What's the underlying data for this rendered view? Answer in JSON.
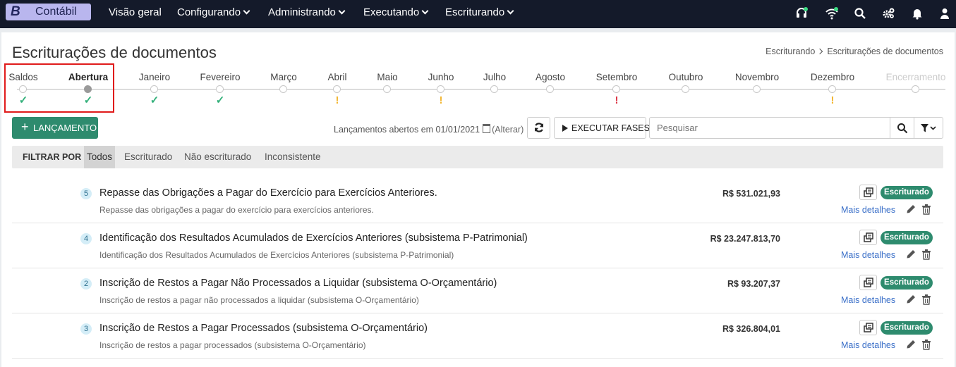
{
  "navbar": {
    "brand_letter": "B",
    "brand_name": "Contábil",
    "items": [
      {
        "label": "Visão geral"
      },
      {
        "label": "Configurando"
      },
      {
        "label": "Administrando"
      },
      {
        "label": "Executando"
      },
      {
        "label": "Escriturando"
      }
    ],
    "icons": [
      "headset-icon",
      "wifi-icon",
      "search-icon",
      "settings-icon",
      "bell-icon",
      "user-icon"
    ],
    "status_color": "#3ddc84"
  },
  "page": {
    "title": "Escriturações de documentos",
    "breadcrumb": [
      "Escriturando",
      "Escriturações de documentos"
    ]
  },
  "timeline": {
    "steps": [
      {
        "label": "Saldos",
        "status": "ok"
      },
      {
        "label": "Abertura",
        "status": "ok",
        "current": true
      },
      {
        "label": "Janeiro",
        "status": "ok"
      },
      {
        "label": "Fevereiro",
        "status": "ok"
      },
      {
        "label": "Março",
        "status": ""
      },
      {
        "label": "Abril",
        "status": "warn"
      },
      {
        "label": "Maio",
        "status": ""
      },
      {
        "label": "Junho",
        "status": "warn"
      },
      {
        "label": "Julho",
        "status": ""
      },
      {
        "label": "Agosto",
        "status": ""
      },
      {
        "label": "Setembro",
        "status": "error"
      },
      {
        "label": "Outubro",
        "status": ""
      },
      {
        "label": "Novembro",
        "status": ""
      },
      {
        "label": "Dezembro",
        "status": "warn"
      },
      {
        "label": "Encerramento",
        "status": "",
        "disabled": true
      }
    ],
    "glyphs": {
      "ok": "✓",
      "warn": "!",
      "error": "!"
    }
  },
  "toolbar": {
    "add_icon": "+",
    "add_label": "LANÇAMENTO",
    "open_text": "Lançamentos abertos em 01/01/2021",
    "alter_link": "(Alterar)",
    "exec_label": "EXECUTAR FASES",
    "search_placeholder": "Pesquisar"
  },
  "filter": {
    "label": "FILTRAR POR",
    "options": [
      "Todos",
      "Escriturado",
      "Não escriturado",
      "Inconsistente"
    ],
    "active": "Todos"
  },
  "rows": [
    {
      "num": "5",
      "title": "Repasse das Obrigações a Pagar do Exercício para Exercícios Anteriores.",
      "desc": "Repasse das obrigações a pagar do exercício para exercícios anteriores.",
      "amount": "R$ 531.021,93",
      "status": "Escriturado",
      "more": "Mais detalhes"
    },
    {
      "num": "4",
      "title": "Identificação dos Resultados Acumulados de Exercícios Anteriores (subsistema P-Patrimonial)",
      "desc": "Identificação dos Resultados Acumulados de Exercícios Anteriores (subsistema P-Patrimonial)",
      "amount": "R$ 23.247.813,70",
      "status": "Escriturado",
      "more": "Mais detalhes"
    },
    {
      "num": "2",
      "title": "Inscrição de Restos a Pagar Não Processados a Liquidar (subsistema O-Orçamentário)",
      "desc": "Inscrição de restos a pagar não processados a liquidar (subsistema O-Orçamentário)",
      "amount": "R$ 93.207,37",
      "status": "Escriturado",
      "more": "Mais detalhes"
    },
    {
      "num": "3",
      "title": "Inscrição de Restos a Pagar Processados (subsistema O-Orçamentário)",
      "desc": "Inscrição de restos a pagar processados (subsistema O-Orçamentário)",
      "amount": "R$ 326.804,01",
      "status": "Escriturado",
      "more": "Mais detalhes"
    }
  ],
  "colors": {
    "accent": "#2e8b6e",
    "navbar": "#141a2a",
    "brand": "#b9b6ee",
    "ok": "#33b07a",
    "warn": "#f2b632",
    "error": "#dc3545",
    "link": "#3a6fc8"
  }
}
